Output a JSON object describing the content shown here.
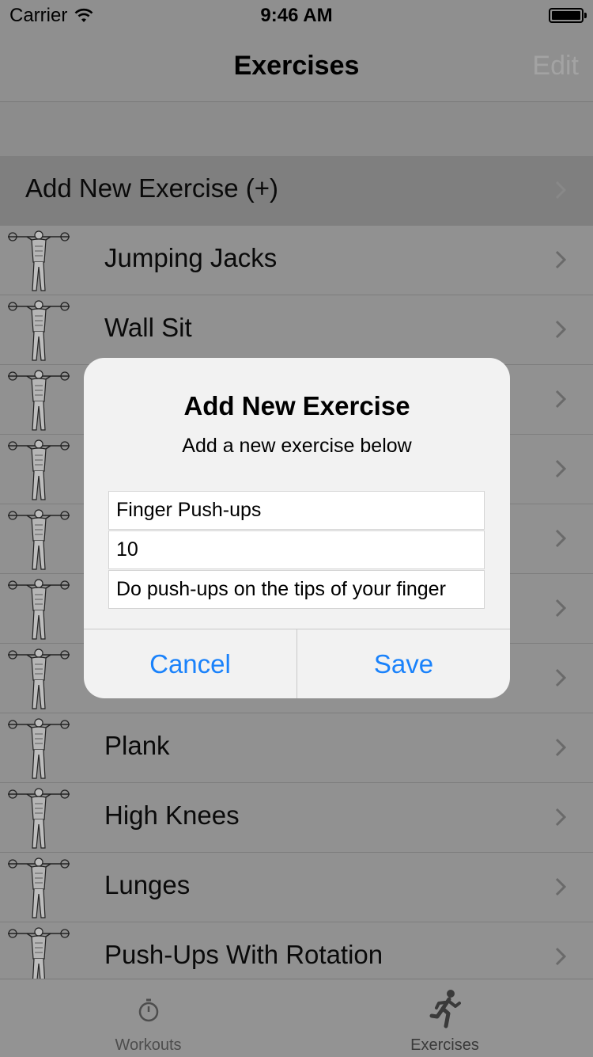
{
  "status_bar": {
    "carrier": "Carrier",
    "time": "9:46 AM"
  },
  "nav": {
    "title": "Exercises",
    "edit_label": "Edit"
  },
  "list": {
    "add_item": "Add New Exercise (+)",
    "items": [
      "Jumping Jacks",
      "Wall Sit",
      "",
      "",
      "",
      "",
      "",
      "Plank",
      "High Knees",
      "Lunges",
      "Push-Ups With Rotation"
    ]
  },
  "alert": {
    "title": "Add New Exercise",
    "message": "Add a new exercise below",
    "name_value": "Finger Push-ups",
    "reps_value": "10",
    "description_value": "Do push-ups on the tips of your finger",
    "cancel_label": "Cancel",
    "save_label": "Save"
  },
  "tab_bar": {
    "tabs": [
      {
        "label": "Workouts",
        "icon": "stopwatch-icon",
        "selected": false
      },
      {
        "label": "Exercises",
        "icon": "runner-icon",
        "selected": true
      }
    ]
  },
  "colors": {
    "accent": "#1a82fb",
    "dim_overlay": "#8f8f8f"
  }
}
